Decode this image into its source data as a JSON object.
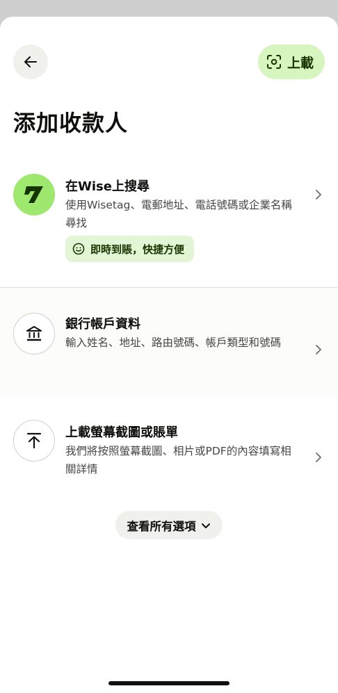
{
  "header": {
    "upload_label": "上載",
    "page_title": "添加收款人"
  },
  "options": [
    {
      "title": "在Wise上搜尋",
      "description": "使用Wisetag、電郵地址、電話號碼或企業名稱尋找",
      "badge": "即時到賬，快捷方便",
      "icon": "wise-logo-icon"
    },
    {
      "title": "銀行帳戶資料",
      "description": "輸入姓名、地址、路由號碼、帳戶類型和號碼",
      "icon": "bank-icon"
    },
    {
      "title": "上載螢幕截圖或賬單",
      "description": "我們將按照螢幕截圖、相片或PDF的內容填寫相關詳情",
      "icon": "upload-arrow-icon"
    }
  ],
  "see_all": {
    "label": "查看所有選項"
  },
  "colors": {
    "accent_green": "#9fe870",
    "upload_button_bg": "#d6f5bf",
    "badge_bg": "#e2f6d5",
    "dark_green_text": "#163300"
  }
}
